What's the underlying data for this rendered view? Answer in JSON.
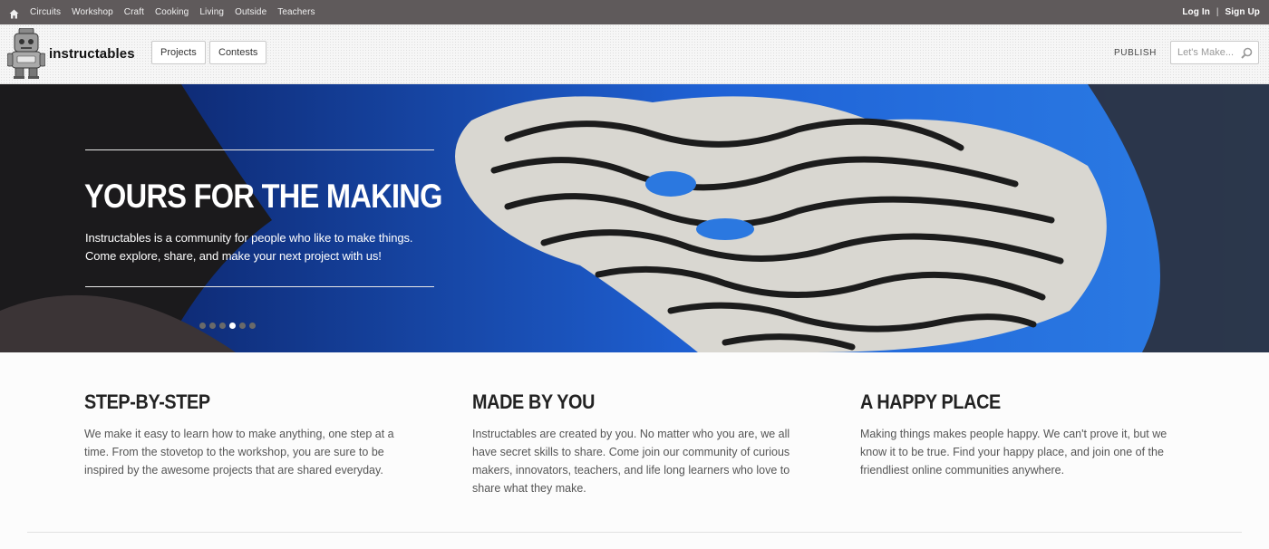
{
  "topbar": {
    "categories": [
      "Circuits",
      "Workshop",
      "Craft",
      "Cooking",
      "Living",
      "Outside",
      "Teachers"
    ],
    "login": "Log In",
    "separator": "|",
    "signup": "Sign Up"
  },
  "header": {
    "brand": "instructables",
    "projects": "Projects",
    "contests": "Contests",
    "publish": "PUBLISH",
    "search_placeholder": "Let's Make..."
  },
  "hero": {
    "title": "YOURS FOR THE MAKING",
    "line1": "Instructables is a community for people who like to make things.",
    "line2": "Come explore, share, and make your next project with us!",
    "slides_total": 6,
    "slide_active": 4
  },
  "features": [
    {
      "title": "STEP-BY-STEP",
      "text": "We make it easy to learn how to make anything, one step at a time. From the stovetop to the workshop, you are sure to be inspired by the awesome projects that are shared everyday."
    },
    {
      "title": "MADE BY YOU",
      "text": "Instructables are created by you. No matter who you are, we all have secret skills to share. Come join our community of curious makers, innovators, teachers, and life long learners who love to share what they make."
    },
    {
      "title": "A HAPPY PLACE",
      "text": "Making things makes people happy. We can't prove it, but we know it to be true. Find your happy place, and join one of the friendliest online communities anywhere."
    }
  ],
  "colors": {
    "topbar": "#5f5a5b",
    "hero_blue": "#1f62d6",
    "hero_dark": "#1b1a1c"
  }
}
